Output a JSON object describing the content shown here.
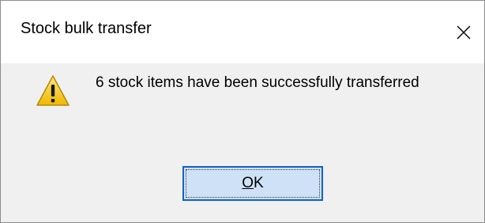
{
  "dialog": {
    "title": "Stock bulk transfer",
    "message": "6 stock items have been successfully transferred",
    "icon": "warning-icon",
    "close_icon": "close-icon",
    "ok_button": {
      "mnemonic": "O",
      "rest": "K"
    }
  },
  "colors": {
    "titlebar_bg": "#ffffff",
    "body_bg": "#f0f0f0",
    "ok_button_bg": "#cfe1f6",
    "ok_button_border": "#0a64c8",
    "warning_yellow": "#f5c400"
  }
}
